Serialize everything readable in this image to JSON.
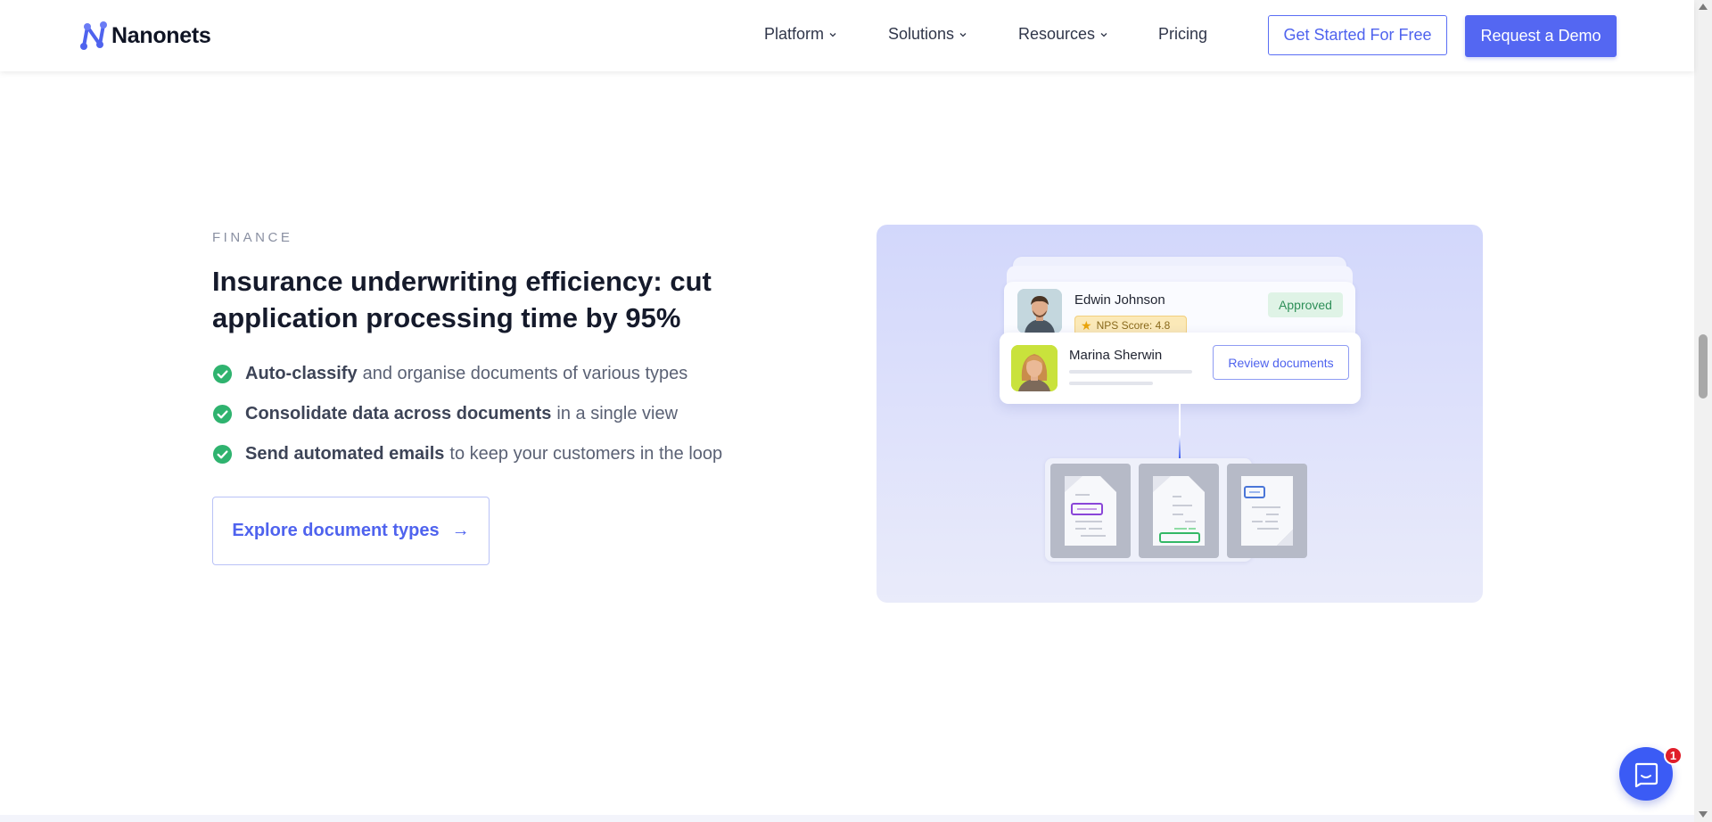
{
  "header": {
    "logo_text": "Nanonets",
    "nav": [
      {
        "label": "Platform",
        "has_dropdown": true
      },
      {
        "label": "Solutions",
        "has_dropdown": true
      },
      {
        "label": "Resources",
        "has_dropdown": true
      },
      {
        "label": "Pricing",
        "has_dropdown": false
      }
    ],
    "cta_outline": "Get Started For Free",
    "cta_solid": "Request a Demo"
  },
  "section": {
    "eyebrow": "FINANCE",
    "title": "Insurance underwriting efficiency: cut application processing time by 95%",
    "features": [
      {
        "bold": "Auto-classify",
        "rest": "and organise documents of various types"
      },
      {
        "bold": "Consolidate data across documents",
        "rest": "in a single view"
      },
      {
        "bold": "Send automated emails",
        "rest": "to keep your customers in the loop"
      }
    ],
    "explore_button": "Explore document types",
    "explore_arrow": "→"
  },
  "illustration": {
    "card_a": {
      "name": "Edwin Johnson",
      "nps": "NPS Score: 4.8",
      "status": "Approved"
    },
    "card_b": {
      "name": "Marina Sherwin",
      "action": "Review documents"
    }
  },
  "chat": {
    "badge_count": "1"
  },
  "colors": {
    "accent": "#5467f2",
    "check_green": "#2fb36f",
    "illustration_bg": "#d2d7fb",
    "approved_bg": "#dff3e6"
  }
}
